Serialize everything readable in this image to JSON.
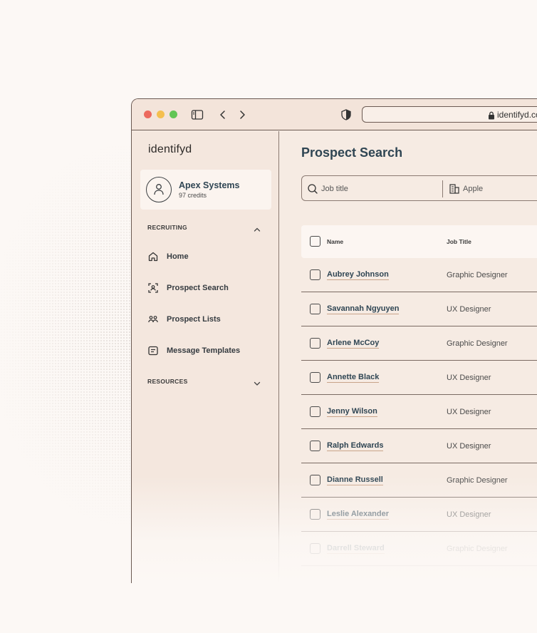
{
  "browser": {
    "url": "identifyd.co",
    "colors": {
      "close": "#ec6a5e",
      "minimize": "#f4bf4f",
      "maximize": "#61c554"
    }
  },
  "sidebar": {
    "logo": "identifyd",
    "account": {
      "name": "Apex Systems",
      "credits": "97 credits"
    },
    "sections": [
      {
        "label": "RECRUITING",
        "state": "expanded"
      },
      {
        "label": "RESOURCES",
        "state": "collapsed"
      }
    ],
    "items": [
      {
        "label": "Home",
        "icon": "home-icon"
      },
      {
        "label": "Prospect Search",
        "icon": "scan-user-icon"
      },
      {
        "label": "Prospect Lists",
        "icon": "users-icon"
      },
      {
        "label": "Message Templates",
        "icon": "message-icon"
      }
    ]
  },
  "main": {
    "title": "Prospect Search",
    "search": {
      "job_title_placeholder": "Job title",
      "company_value": "Apple"
    },
    "table": {
      "headers": {
        "name": "Name",
        "job_title": "Job Title"
      },
      "rows": [
        {
          "name": "Aubrey Johnson",
          "job_title": "Graphic Designer"
        },
        {
          "name": "Savannah Ngyuyen",
          "job_title": "UX Designer"
        },
        {
          "name": "Arlene McCoy",
          "job_title": "Graphic Designer"
        },
        {
          "name": "Annette Black",
          "job_title": "UX Designer"
        },
        {
          "name": "Jenny Wilson",
          "job_title": "UX Designer"
        },
        {
          "name": "Ralph Edwards",
          "job_title": "UX Designer"
        },
        {
          "name": "Dianne Russell",
          "job_title": "Graphic Designer"
        },
        {
          "name": "Leslie Alexander",
          "job_title": "UX Designer"
        },
        {
          "name": "Darrell Steward",
          "job_title": "Graphic Designer"
        }
      ]
    }
  }
}
